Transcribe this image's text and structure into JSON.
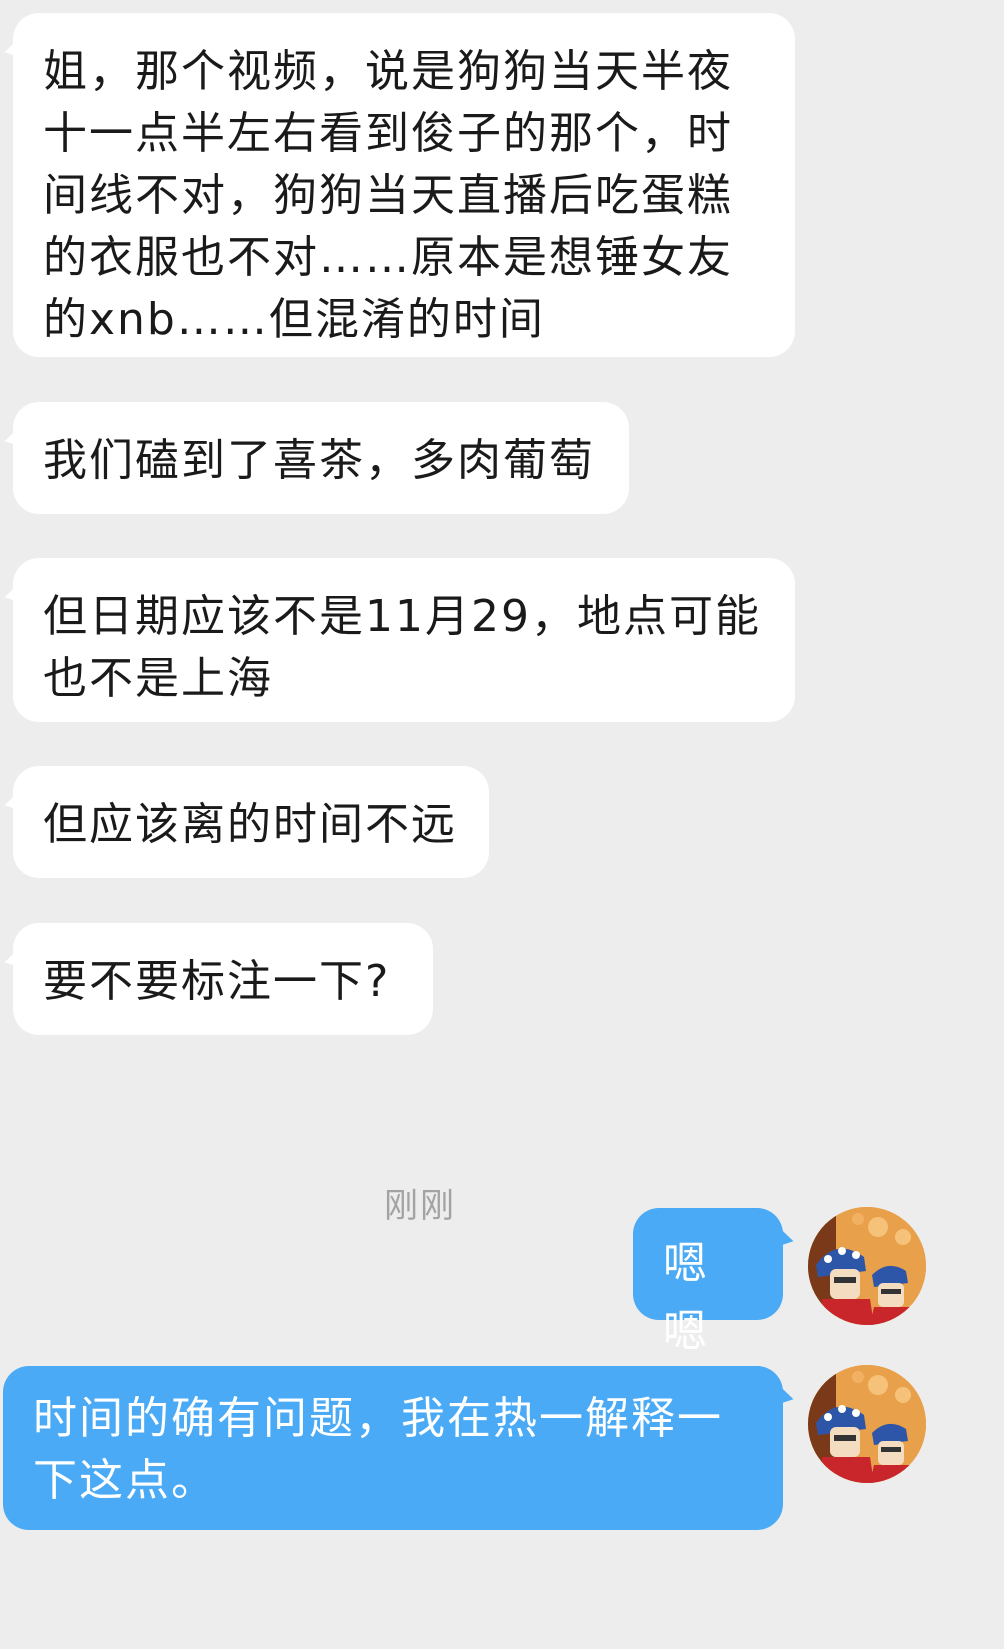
{
  "chat": {
    "incoming": [
      "姐，那个视频，说是狗狗当天半夜十一点半左右看到俊子的那个，时间线不对，狗狗当天直播后吃蛋糕的衣服也不对……原本是想锤女友的xnb……但混淆的时间",
      "我们磕到了喜茶，多肉葡萄",
      "但日期应该不是11月29，地点可能也不是上海",
      "但应该离的时间不远",
      "要不要标注一下?"
    ],
    "timestamp": "刚刚",
    "outgoing": [
      "嗯嗯",
      "时间的确有问题，我在热一解释一下这点。"
    ]
  },
  "avatar": {
    "icon": "cartoon-figures-avatar",
    "colors": {
      "background": "#e8a04a",
      "hat": "#2e56a8",
      "face": "#f3dcc0",
      "robe": "#c8262b"
    }
  },
  "theme": {
    "background": "#ededed",
    "incoming_bubble": "#ffffff",
    "outgoing_bubble": "#4aaaf5",
    "text": "#1a1a1a",
    "timestamp": "#a3a3a3"
  }
}
